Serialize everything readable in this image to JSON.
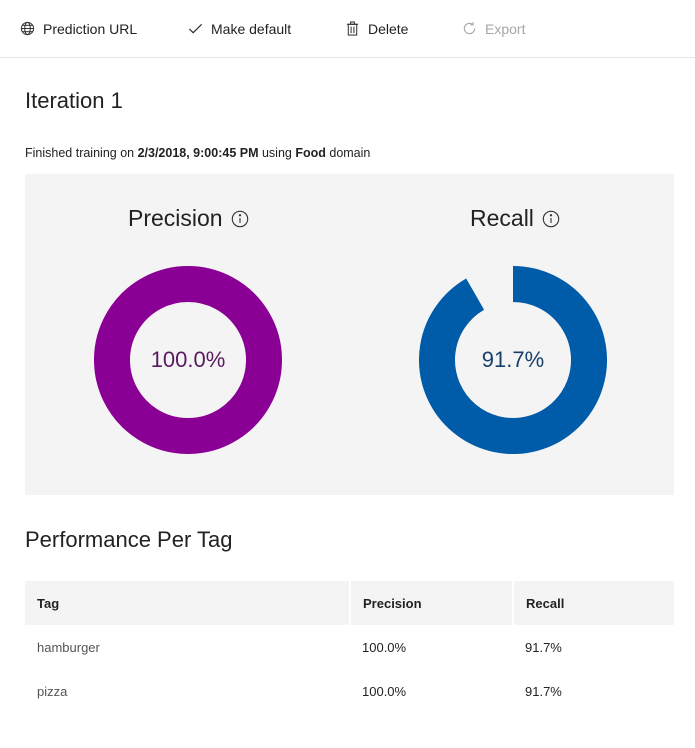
{
  "toolbar": {
    "prediction_url": "Prediction URL",
    "make_default": "Make default",
    "delete": "Delete",
    "export": "Export"
  },
  "iteration": {
    "title": "Iteration 1",
    "subtitle_prefix": "Finished training on ",
    "date": "2/3/2018, 9:00:45 PM",
    "subtitle_mid": " using ",
    "domain": "Food",
    "subtitle_suffix": " domain"
  },
  "metrics": {
    "precision": {
      "label": "Precision",
      "value": "100.0%",
      "fraction": 1.0,
      "color": "#8b0094"
    },
    "recall": {
      "label": "Recall",
      "value": "91.7%",
      "fraction": 0.917,
      "color": "#005ba9"
    },
    "precision_text_color": "#5a1a60",
    "recall_text_color": "#17406a"
  },
  "performance": {
    "title": "Performance Per Tag",
    "columns": [
      "Tag",
      "Precision",
      "Recall"
    ],
    "rows": [
      {
        "tag": "hamburger",
        "precision": "100.0%",
        "recall": "91.7%"
      },
      {
        "tag": "pizza",
        "precision": "100.0%",
        "recall": "91.7%"
      }
    ]
  },
  "icons": {
    "prediction_url": "globe-icon",
    "make_default": "checkmark-icon",
    "delete": "trash-icon",
    "export": "refresh-icon",
    "info": "info-icon"
  }
}
